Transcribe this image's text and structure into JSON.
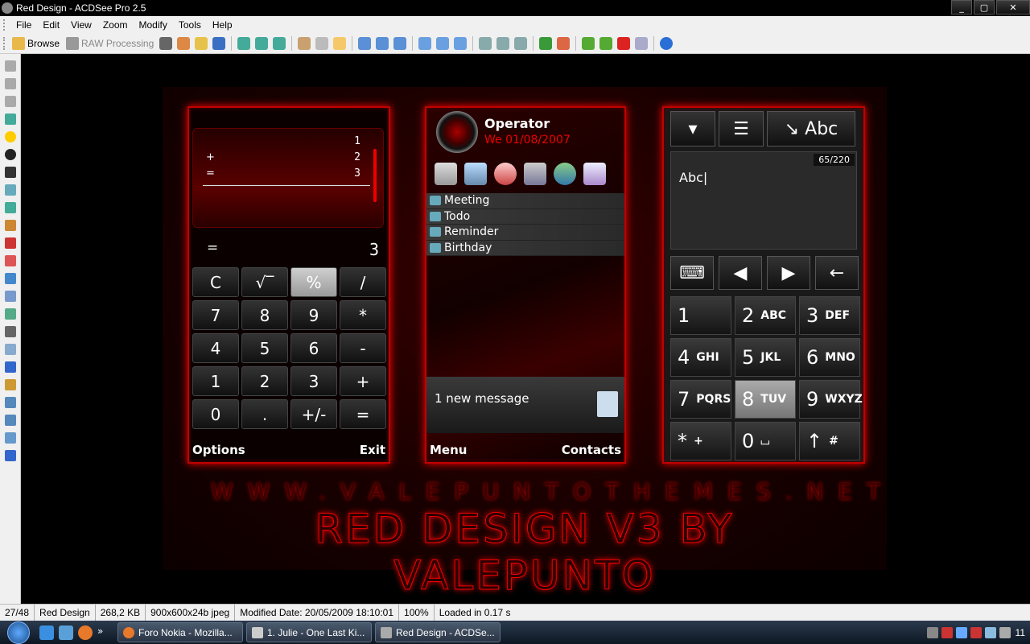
{
  "window": {
    "title": "Red Design - ACDSee Pro 2.5",
    "buttons": [
      "_",
      "▢",
      "✕"
    ]
  },
  "menu": [
    "File",
    "Edit",
    "View",
    "Zoom",
    "Modify",
    "Tools",
    "Help"
  ],
  "menu_underline": [
    "F",
    "E",
    "V",
    "Z",
    "M",
    "T",
    "H"
  ],
  "toolbar": {
    "browse": "Browse",
    "raw": "RAW Processing"
  },
  "calc": {
    "lines": [
      "1",
      "2",
      "3"
    ],
    "ops": [
      "+",
      "="
    ],
    "result_eq": "=",
    "result_val": "3",
    "keys": [
      "C",
      "√‾",
      "%",
      "/",
      "7",
      "8",
      "9",
      "*",
      "4",
      "5",
      "6",
      "-",
      "1",
      "2",
      "3",
      "+",
      "0",
      ".",
      "+/-",
      "="
    ],
    "soft_left": "Options",
    "soft_right": "Exit"
  },
  "home": {
    "operator": "Operator",
    "date": "We 01/08/2007",
    "list": [
      "Meeting",
      "Todo",
      "Reminder",
      "Birthday"
    ],
    "message": "1 new message",
    "soft_left": "Menu",
    "soft_right": "Contacts"
  },
  "keypad": {
    "top_buttons": [
      "▾",
      "☰",
      "↘ Abc"
    ],
    "counter": "65/220",
    "text": "Abc|",
    "nav": [
      "⌨",
      "◀",
      "▶",
      "←"
    ],
    "keys": [
      {
        "n": "1",
        "l": ""
      },
      {
        "n": "2",
        "l": "ABC"
      },
      {
        "n": "3",
        "l": "DEF"
      },
      {
        "n": "4",
        "l": "GHI"
      },
      {
        "n": "5",
        "l": "JKL"
      },
      {
        "n": "6",
        "l": "MNO"
      },
      {
        "n": "7",
        "l": "PQRS"
      },
      {
        "n": "8",
        "l": "TUV"
      },
      {
        "n": "9",
        "l": "WXYZ"
      },
      {
        "n": "*",
        "l": "+"
      },
      {
        "n": "0",
        "l": "⌴"
      },
      {
        "n": "↑",
        "l": "#"
      }
    ]
  },
  "banner": {
    "url": "WWW.VALEPUNTOTHEMES.NET",
    "title": "RED DESIGN V3 BY VALEPUNTO"
  },
  "status": [
    "27/48",
    "Red Design",
    "268,2 KB",
    "900x600x24b jpeg",
    "Modified Date: 20/05/2009 18:10:01",
    "100%",
    "Loaded in 0.17 s"
  ],
  "taskbar": {
    "tasks": [
      "Foro Nokia - Mozilla...",
      "1. Julie - One Last Ki...",
      "Red Design - ACDSe..."
    ],
    "time": "11"
  },
  "colors": {
    "accent": "#cc0000",
    "taskbar": "#1a2738"
  }
}
